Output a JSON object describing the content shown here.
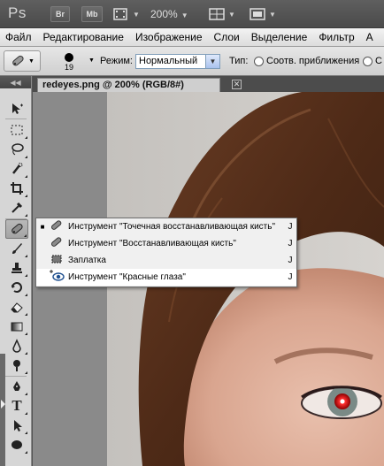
{
  "app_bar": {
    "logo": "Ps",
    "bridge_button": "Br",
    "minibridge_button": "Mb",
    "zoom": "200%",
    "icons": [
      "film-strip-icon",
      "arrange-documents-icon",
      "screen-mode-icon"
    ]
  },
  "menu": {
    "items": [
      "Файл",
      "Редактирование",
      "Изображение",
      "Слои",
      "Выделение",
      "Фильтр",
      "А"
    ]
  },
  "options_bar": {
    "brush_size": "19",
    "mode_label": "Режим:",
    "mode_value": "Нормальный",
    "type_label": "Тип:",
    "type_options": [
      "Соотв. приближения",
      "С"
    ]
  },
  "document": {
    "tab_title": "redeyes.png @ 200% (RGB/8#)",
    "close_symbol": "✕"
  },
  "toolbox": {
    "tools": [
      "move-tool",
      "marquee-tool",
      "lasso-tool",
      "quick-selection-tool",
      "crop-tool",
      "eyedropper-tool",
      "spot-healing-tool",
      "brush-tool",
      "clone-stamp-tool",
      "history-brush-tool",
      "eraser-tool",
      "gradient-tool",
      "blur-tool",
      "dodge-tool",
      "pen-tool",
      "type-tool",
      "path-selection-tool",
      "shape-tool"
    ]
  },
  "flyout_menu": {
    "items": [
      {
        "label": "Инструмент \"Точечная восстанавливающая кисть\"",
        "shortcut": "J",
        "active": true,
        "icon": "spot-healing-brush-icon"
      },
      {
        "label": "Инструмент \"Восстанавливающая кисть\"",
        "shortcut": "J",
        "active": false,
        "icon": "healing-brush-icon"
      },
      {
        "label": "Заплатка",
        "shortcut": "J",
        "active": false,
        "icon": "patch-icon"
      },
      {
        "label": "Инструмент \"Красные глаза\"",
        "shortcut": "J",
        "active": false,
        "icon": "red-eye-icon"
      }
    ]
  }
}
